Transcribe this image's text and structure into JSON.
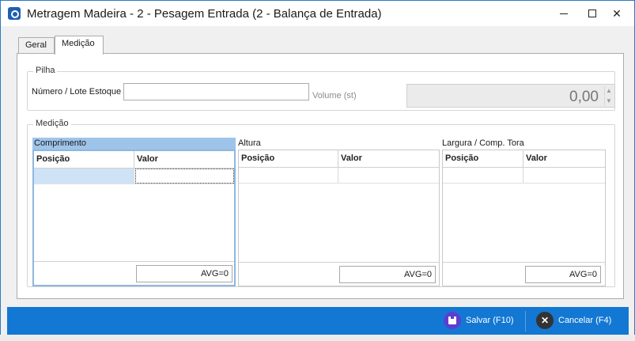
{
  "window": {
    "title": "Metragem Madeira - 2 - Pesagem Entrada (2 - Balança de Entrada)",
    "minimize_glyph": "",
    "close_glyph": "✕"
  },
  "tabs": [
    {
      "label": "Geral",
      "active": false
    },
    {
      "label": "Medição",
      "active": true
    }
  ],
  "pilha": {
    "legend": "Pilha",
    "lote_label": "Número / Lote Estoque",
    "lote_value": "",
    "volume_label": "Volume (st)",
    "volume_value": "0,00"
  },
  "medicao": {
    "legend": "Medição",
    "grids": [
      {
        "title": "Comprimento",
        "col_pos": "Posição",
        "col_val": "Valor",
        "avg": "AVG=0",
        "active": true
      },
      {
        "title": "Altura",
        "col_pos": "Posição",
        "col_val": "Valor",
        "avg": "AVG=0",
        "active": false
      },
      {
        "title": "Largura / Comp. Tora",
        "col_pos": "Posição",
        "col_val": "Valor",
        "avg": "AVG=0",
        "active": false
      }
    ]
  },
  "actions": {
    "save_label": "Salvar (F10)",
    "cancel_label": "Cancelar (F4)",
    "cancel_glyph": "✕"
  },
  "colors": {
    "accent_bar": "#1378d3",
    "active_grid": "#9ec4ea",
    "save_icon": "#5b3fd1"
  }
}
